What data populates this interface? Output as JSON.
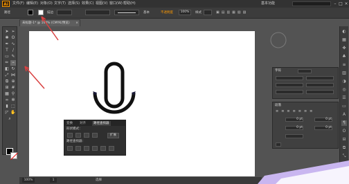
{
  "app": {
    "logo": "Ai"
  },
  "menu": [
    "文件(F)",
    "编辑(E)",
    "对象(O)",
    "文字(T)",
    "选择(S)",
    "效果(C)",
    "视图(V)",
    "窗口(W)",
    "帮助(H)"
  ],
  "workspace": {
    "label": "基本功能",
    "search_placeholder": ""
  },
  "control_bar": {
    "selection": "路径",
    "stroke_label": "描边",
    "stroke_weight": "",
    "style": "基本",
    "opacity_label": "不透明度",
    "opacity": "100%",
    "style_label": "样式"
  },
  "document_tab": {
    "title": "未标题-1* @ 100% (CMYK/预览)",
    "close": "×"
  },
  "statusbar": {
    "zoom": "100%",
    "page": "1",
    "mode": "选择"
  },
  "character_panel": {
    "title": "字符",
    "font": "",
    "size": "",
    "rows": [
      "",
      "",
      ""
    ]
  },
  "paragraph_panel": {
    "title": "段落",
    "rows": [
      "",
      "",
      "",
      "",
      ""
    ],
    "values": [
      "0 pt",
      "0 pt",
      "0 pt",
      "0 pt"
    ]
  },
  "pathfinder_panel": {
    "tabs": [
      "变换",
      "对齐",
      "路径查找器"
    ],
    "shape_modes_label": "形状模式：",
    "expand": "扩展",
    "pathfinders_label": "路径查找器："
  },
  "colors": {
    "accent": "#ff9a00",
    "arrow": "#d94040",
    "bg": "#535353",
    "panel": "#404040"
  }
}
